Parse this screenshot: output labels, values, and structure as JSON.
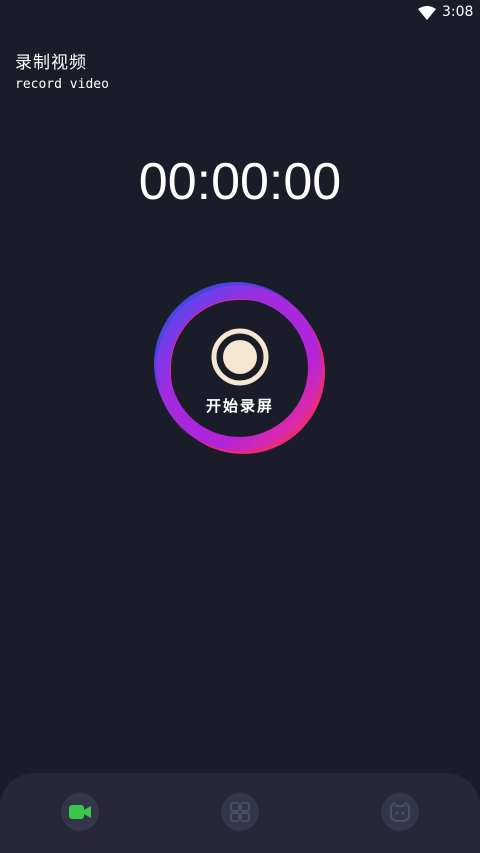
{
  "status_bar": {
    "time": "3:08",
    "wifi_icon": "wifi-icon"
  },
  "header": {
    "title": "录制视频",
    "subtitle": "record video"
  },
  "timer": {
    "value": "00:00:00"
  },
  "record_button": {
    "label": "开始录屏",
    "icon": "record-dot-icon"
  },
  "bottom_nav": {
    "items": [
      {
        "icon": "video-camera-icon",
        "active": true
      },
      {
        "icon": "grid-icon",
        "active": false
      },
      {
        "icon": "profile-icon",
        "active": false
      }
    ]
  },
  "colors": {
    "background": "#1b1c29",
    "nav_background": "#262839",
    "nav_button": "#33364a",
    "ring_purple": "#b324d8",
    "ring_blue": "#4a4cf2",
    "ring_pink": "#ff2f7f",
    "record_dot": "#f6e7d3",
    "active_icon": "#37c84a"
  }
}
